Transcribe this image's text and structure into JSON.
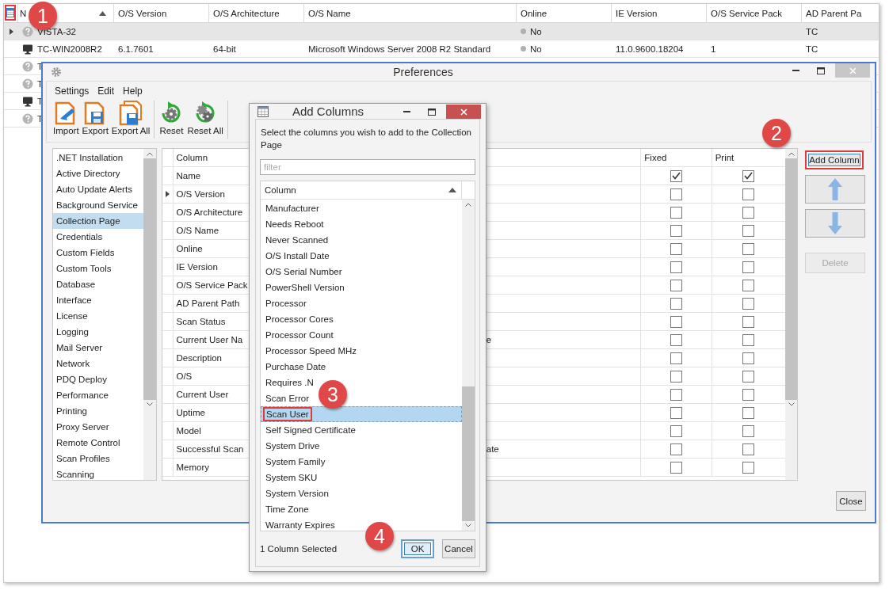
{
  "grid": {
    "column_selector": {
      "highlighted": true
    },
    "columns": [
      {
        "label": "N",
        "sorted": true
      },
      {
        "label": "O/S Version",
        "sorted": false
      },
      {
        "label": "O/S Architecture",
        "sorted": false
      },
      {
        "label": "O/S Name",
        "sorted": false
      },
      {
        "label": "Online",
        "sorted": false
      },
      {
        "label": "IE Version",
        "sorted": false
      },
      {
        "label": "O/S Service Pack",
        "sorted": false
      },
      {
        "label": "AD Parent Pa",
        "sorted": false
      }
    ],
    "rows": [
      {
        "kind": "unknown",
        "selected": true,
        "current": true,
        "name": "VISTA-32",
        "online": "No",
        "ad_parent_path": "TC"
      },
      {
        "kind": "computer",
        "selected": false,
        "current": false,
        "name": "TC-WIN2008R2",
        "os_version": "6.1.7601",
        "os_architecture": "64-bit",
        "os_name": "Microsoft Windows Server 2008 R2 Standard",
        "online": "No",
        "ie_version": "11.0.9600.18204",
        "os_service_pack": "1",
        "ad_parent_path": "TC"
      },
      {
        "kind": "unknown",
        "selected": false,
        "current": false,
        "name": "T"
      },
      {
        "kind": "unknown",
        "selected": false,
        "current": false,
        "name": "T"
      },
      {
        "kind": "computer",
        "selected": false,
        "current": false,
        "name": "T"
      },
      {
        "kind": "unknown",
        "selected": false,
        "current": false,
        "name": "T"
      }
    ]
  },
  "preferences": {
    "title": "Preferences",
    "menu": [
      "Settings",
      "Edit",
      "Help"
    ],
    "toolbar": [
      {
        "kind": "import",
        "label": "Import"
      },
      {
        "kind": "export",
        "label": "Export"
      },
      {
        "kind": "export_all",
        "label": "Export All"
      },
      {
        "kind": "reset",
        "label": "Reset"
      },
      {
        "kind": "reset_all",
        "label": "Reset All"
      }
    ],
    "sidebar": {
      "items": [
        {
          "label": ".NET Installation",
          "selected": false
        },
        {
          "label": "Active Directory",
          "selected": false
        },
        {
          "label": "Auto Update Alerts",
          "selected": false
        },
        {
          "label": "Background Service",
          "selected": false
        },
        {
          "label": "Collection Page",
          "selected": true
        },
        {
          "label": "Credentials",
          "selected": false
        },
        {
          "label": "Custom Fields",
          "selected": false
        },
        {
          "label": "Custom Tools",
          "selected": false
        },
        {
          "label": "Database",
          "selected": false
        },
        {
          "label": "Interface",
          "selected": false
        },
        {
          "label": "License",
          "selected": false
        },
        {
          "label": "Logging",
          "selected": false
        },
        {
          "label": "Mail Server",
          "selected": false
        },
        {
          "label": "Network",
          "selected": false
        },
        {
          "label": "PDQ Deploy",
          "selected": false
        },
        {
          "label": "Performance",
          "selected": false
        },
        {
          "label": "Printing",
          "selected": false
        },
        {
          "label": "Proxy Server",
          "selected": false
        },
        {
          "label": "Remote Control",
          "selected": false
        },
        {
          "label": "Scan Profiles",
          "selected": false
        },
        {
          "label": "Scanning",
          "selected": false
        }
      ]
    },
    "columns_table": {
      "headers": {
        "column": "Column",
        "fixed": "Fixed",
        "print": "Print"
      },
      "rows": [
        {
          "column": "Name",
          "current": false,
          "fixed": true,
          "print": true
        },
        {
          "column": "O/S Version",
          "current": true,
          "fixed": false,
          "print": false
        },
        {
          "column": "O/S Architecture",
          "current": false,
          "fixed": false,
          "print": false
        },
        {
          "column": "O/S Name",
          "current": false,
          "fixed": false,
          "print": false
        },
        {
          "column": "Online",
          "current": false,
          "fixed": false,
          "print": false
        },
        {
          "column": "IE Version",
          "current": false,
          "fixed": false,
          "print": false
        },
        {
          "column": "O/S Service Pack",
          "current": false,
          "fixed": false,
          "print": false
        },
        {
          "column": "AD Parent Path",
          "current": false,
          "fixed": false,
          "print": false
        },
        {
          "column": "Scan Status",
          "current": false,
          "fixed": false,
          "print": false
        },
        {
          "column": "Current User Na",
          "column_3": "e",
          "current": false,
          "fixed": false,
          "print": false
        },
        {
          "column": "Description",
          "current": false,
          "fixed": false,
          "print": false
        },
        {
          "column": "O/S",
          "current": false,
          "fixed": false,
          "print": false
        },
        {
          "column": "Current User",
          "current": false,
          "fixed": false,
          "print": false
        },
        {
          "column": "Uptime",
          "current": false,
          "fixed": false,
          "print": false
        },
        {
          "column": "Model",
          "current": false,
          "fixed": false,
          "print": false
        },
        {
          "column": "Successful Scan",
          "column_3": "ate",
          "current": false,
          "fixed": false,
          "print": false
        },
        {
          "column": "Memory",
          "current": false,
          "fixed": false,
          "print": false
        }
      ]
    },
    "buttons": [
      {
        "kind": "add",
        "label": "Add Column",
        "disabled": false,
        "highlighted": true
      },
      {
        "kind": "up",
        "disabled": false,
        "highlighted": false
      },
      {
        "kind": "down",
        "disabled": false,
        "highlighted": false
      },
      {
        "kind": "delete",
        "label": "Delete",
        "disabled": true,
        "highlighted": false
      }
    ],
    "close_button": "Close"
  },
  "dialog": {
    "title": "Add Columns",
    "instructions": "Select the columns you wish to add to the Collection Page",
    "filter": {
      "placeholder": "filter"
    },
    "list_header": "Column",
    "items": [
      {
        "label": "Manufacturer",
        "selected": false
      },
      {
        "label": "Needs Reboot",
        "selected": false
      },
      {
        "label": "Never Scanned",
        "selected": false
      },
      {
        "label": "O/S Install Date",
        "selected": false
      },
      {
        "label": "O/S Serial Number",
        "selected": false
      },
      {
        "label": "PowerShell Version",
        "selected": false
      },
      {
        "label": "Processor",
        "selected": false
      },
      {
        "label": "Processor Cores",
        "selected": false
      },
      {
        "label": "Processor Count",
        "selected": false
      },
      {
        "label": "Processor Speed MHz",
        "selected": false
      },
      {
        "label": "Purchase Date",
        "selected": false
      },
      {
        "label": "Requires .N",
        "selected": false
      },
      {
        "label": "Scan Error",
        "selected": false
      },
      {
        "label": "Scan User",
        "selected": true
      },
      {
        "label": "Self Signed Certificate",
        "selected": false
      },
      {
        "label": "System Drive",
        "selected": false
      },
      {
        "label": "System Family",
        "selected": false
      },
      {
        "label": "System SKU",
        "selected": false
      },
      {
        "label": "System Version",
        "selected": false
      },
      {
        "label": "Time Zone",
        "selected": false
      },
      {
        "label": "Warranty Expires",
        "selected": false
      }
    ],
    "status": "1 Column Selected",
    "buttons": [
      {
        "label": "OK",
        "highlighted": true
      },
      {
        "label": "Cancel",
        "highlighted": false
      }
    ]
  },
  "callouts": [
    "1",
    "2",
    "3",
    "4"
  ]
}
